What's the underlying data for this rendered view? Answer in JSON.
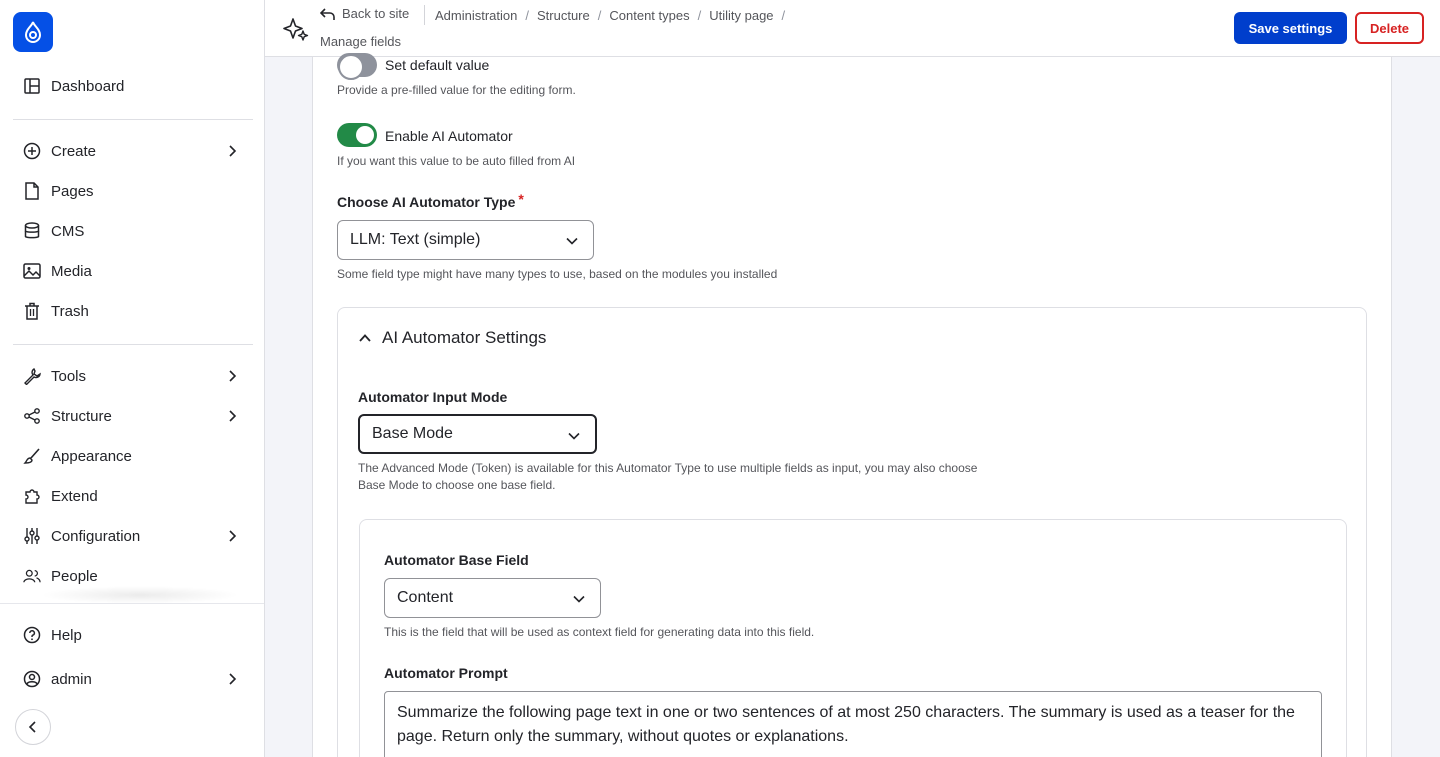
{
  "sidebar": {
    "items": [
      {
        "label": "Dashboard"
      },
      {
        "label": "Create"
      },
      {
        "label": "Pages"
      },
      {
        "label": "CMS"
      },
      {
        "label": "Media"
      },
      {
        "label": "Trash"
      },
      {
        "label": "Tools"
      },
      {
        "label": "Structure"
      },
      {
        "label": "Appearance"
      },
      {
        "label": "Extend"
      },
      {
        "label": "Configuration"
      },
      {
        "label": "People"
      },
      {
        "label": "Help"
      },
      {
        "label": "admin"
      }
    ]
  },
  "header": {
    "back_label": "Back to site",
    "breadcrumbs": [
      "Administration",
      "Structure",
      "Content types",
      "Utility page"
    ],
    "page_title": "Manage fields",
    "save_label": "Save settings",
    "delete_label": "Delete"
  },
  "form": {
    "default_value": {
      "label": "Set default value",
      "description": "Provide a pre-filled value for the editing form.",
      "enabled": false
    },
    "ai_automator": {
      "label": "Enable AI Automator",
      "description": "If you want this value to be auto filled from AI",
      "enabled": true
    },
    "automator_type": {
      "label": "Choose AI Automator Type",
      "required_mark": "*",
      "value": "LLM: Text (simple)",
      "description": "Some field type might have many types to use, based on the modules you installed"
    },
    "settings": {
      "title": "AI Automator Settings",
      "input_mode": {
        "label": "Automator Input Mode",
        "value": "Base Mode",
        "description": "The Advanced Mode (Token) is available for this Automator Type to use multiple fields as input, you may also choose Base Mode to choose one base field."
      },
      "base_field": {
        "label": "Automator Base Field",
        "value": "Content",
        "description": "This is the field that will be used as context field for generating data into this field."
      },
      "prompt": {
        "label": "Automator Prompt",
        "value": "Summarize the following page text in one or two sentences of at most 250 characters. The summary is used as a teaser for the page. Return only the summary, without quotes or explanations."
      }
    }
  },
  "colors": {
    "primary": "#003ecc",
    "danger": "#d72222",
    "toggle_on": "#228a47"
  }
}
